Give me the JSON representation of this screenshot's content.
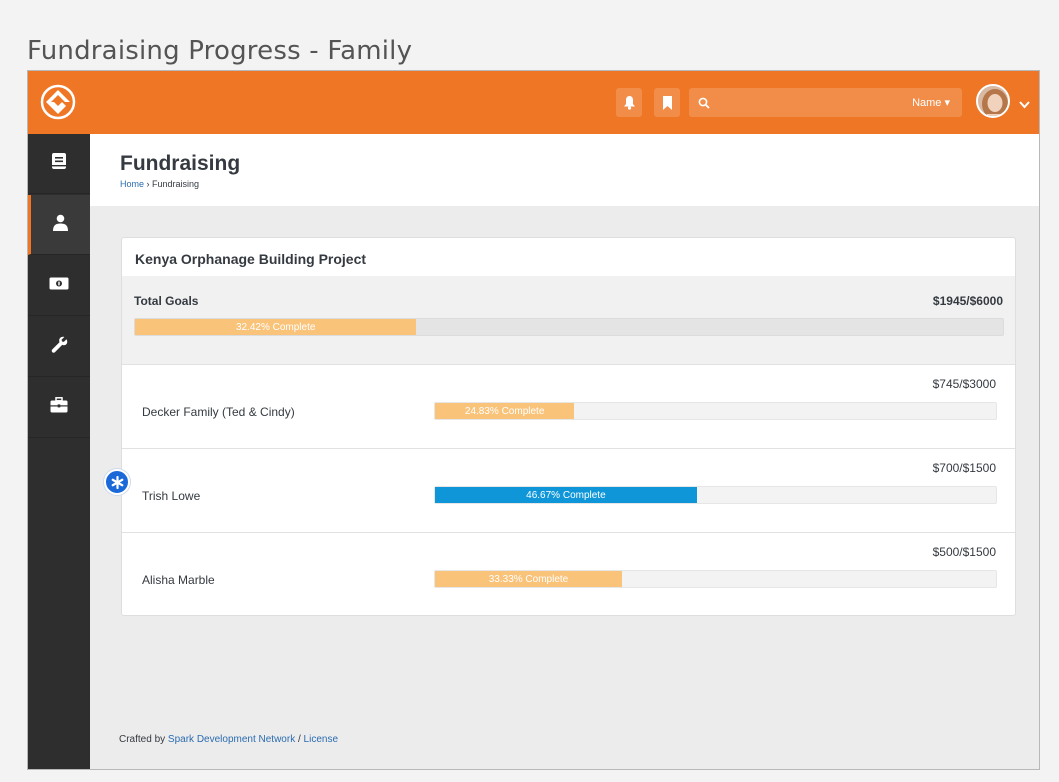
{
  "doc_title": "Fundraising Progress - Family",
  "topbar": {
    "search_filter_label": "Name ▾",
    "icons": [
      "notification-bell-icon",
      "bookmark-icon",
      "search-icon",
      "chevron-down-icon"
    ],
    "accent_color": "#ee7625"
  },
  "sidebar": {
    "items": [
      {
        "icon": "book-icon",
        "active": false
      },
      {
        "icon": "person-icon",
        "active": true
      },
      {
        "icon": "money-icon",
        "active": false
      },
      {
        "icon": "wrench-icon",
        "active": false
      },
      {
        "icon": "briefcase-icon",
        "active": false
      }
    ]
  },
  "header": {
    "title": "Fundraising",
    "breadcrumb": {
      "home": "Home",
      "separator": " › ",
      "current": "Fundraising"
    }
  },
  "panel": {
    "title": "Kenya Orphanage Building Project",
    "total": {
      "label": "Total Goals",
      "amount": "$1945/$6000",
      "progress_text": "32.42% Complete",
      "progress_fraction": 0.3242
    },
    "rows": [
      {
        "name": "Decker Family (Ted & Cindy)",
        "amount": "$745/$3000",
        "progress_text": "24.83% Complete",
        "progress_fraction": 0.2483,
        "color": "orange"
      },
      {
        "name": "Trish Lowe",
        "amount": "$700/$1500",
        "progress_text": "46.67% Complete",
        "progress_fraction": 0.4667,
        "color": "blue"
      },
      {
        "name": "Alisha Marble",
        "amount": "$500/$1500",
        "progress_text": "33.33% Complete",
        "progress_fraction": 0.3333,
        "color": "orange"
      }
    ]
  },
  "footer": {
    "prefix": "Crafted by ",
    "org_link": "Spark Development Network",
    "separator": " / ",
    "license_link": "License"
  },
  "colors": {
    "bar_orange": "#f9c37a",
    "bar_blue": "#0f96d8",
    "badge_blue": "#1b68d8"
  }
}
